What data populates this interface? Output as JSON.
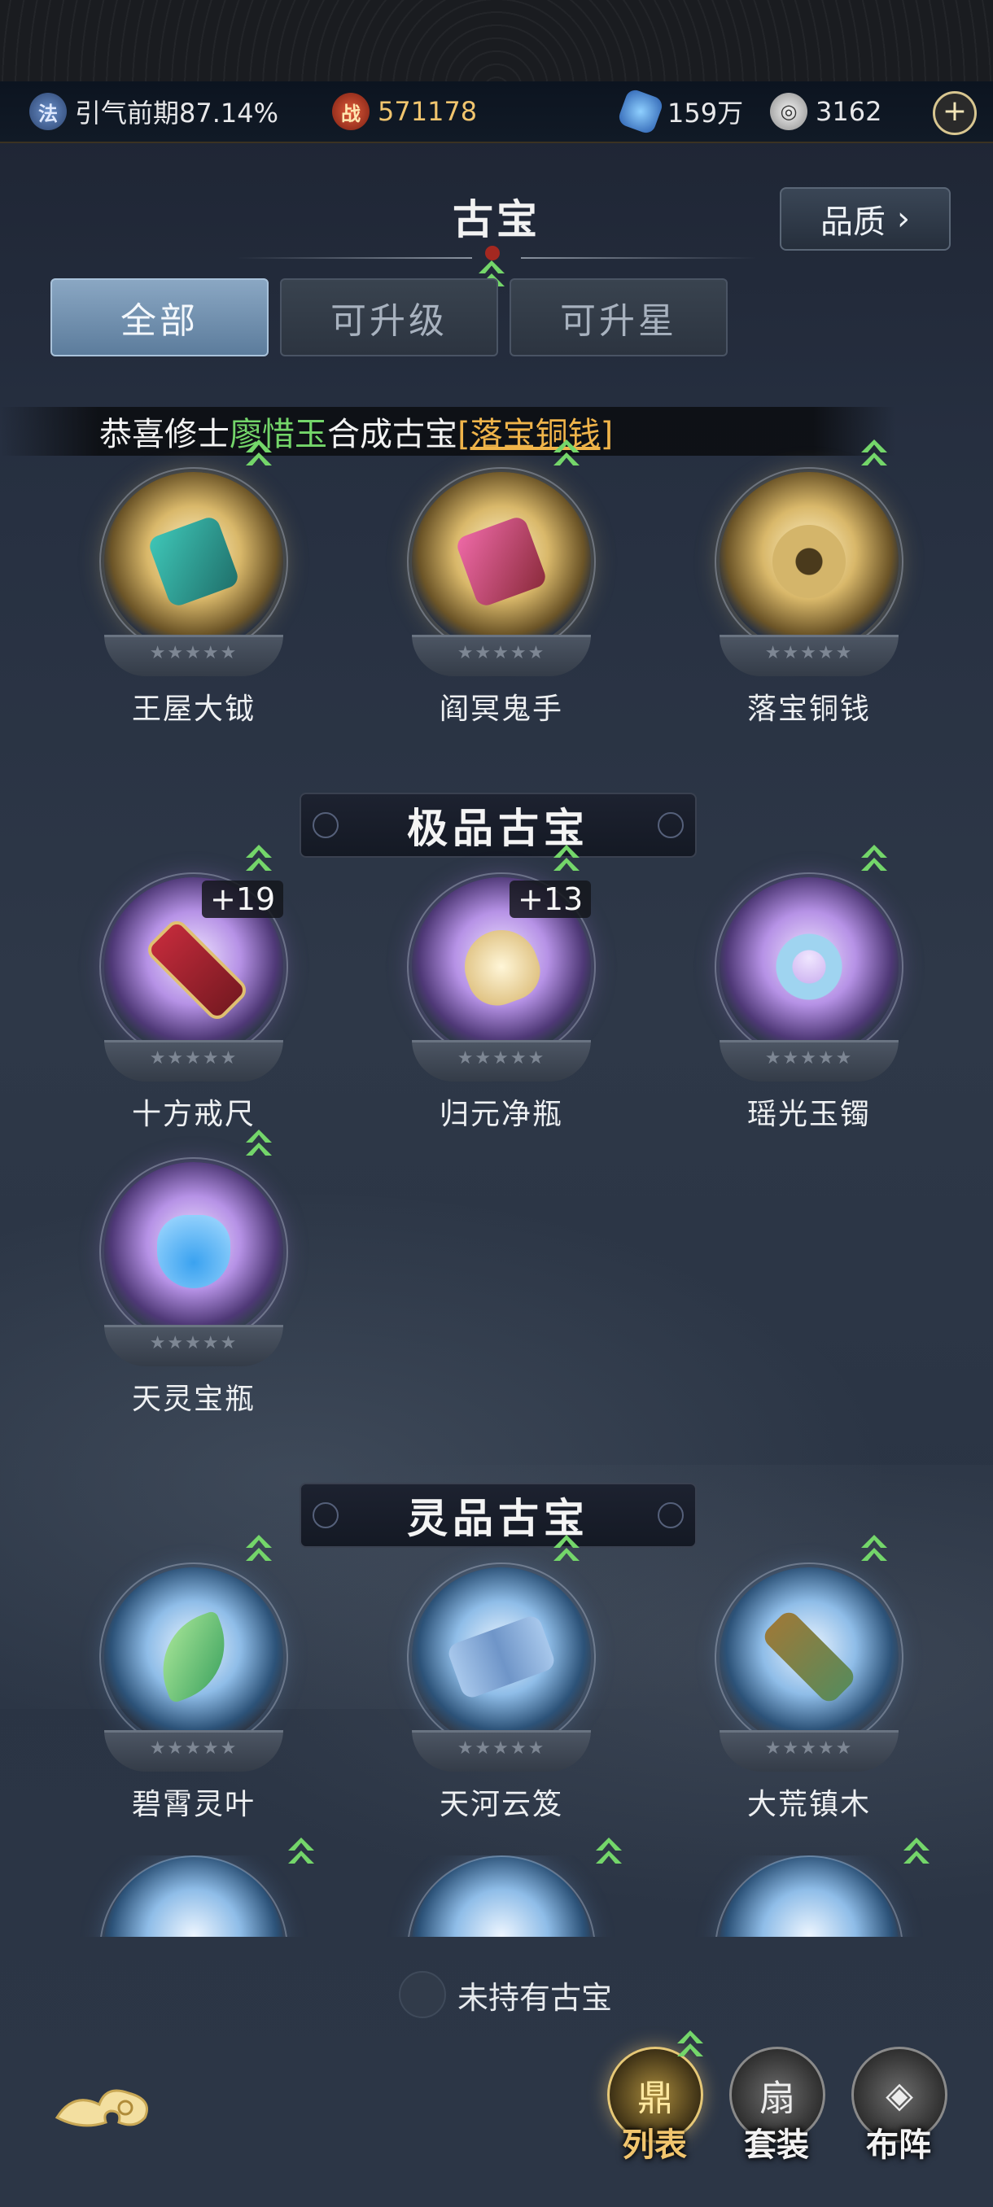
{
  "status": {
    "realm": "引气前期87.14%",
    "power": "571178",
    "gems": "159万",
    "coins": "3162",
    "icon_realm": "fa-seal-icon",
    "icon_power": "zhan-battle-icon",
    "icon_gems": "blue-gem-icon",
    "icon_coins": "silver-coin-icon",
    "power_color": "#f1c56e"
  },
  "header": {
    "title": "古宝",
    "quality_button": "品质",
    "quality_arrow": "›"
  },
  "tabs": [
    {
      "label": "全部",
      "active": true
    },
    {
      "label": "可升级",
      "active": false
    },
    {
      "label": "可升星",
      "active": false
    }
  ],
  "notice": {
    "prefix": "恭喜修士",
    "player": "廖惜玉",
    "middle": "合成古宝",
    "item": "[落宝铜钱]"
  },
  "sections": {
    "rare": "极品古宝",
    "spirit": "灵品古宝"
  },
  "items": {
    "row1": [
      {
        "name": "王屋大钺",
        "level": ""
      },
      {
        "name": "阎冥鬼手",
        "level": ""
      },
      {
        "name": "落宝铜钱",
        "level": ""
      }
    ],
    "row2": [
      {
        "name": "十方戒尺",
        "level": "+19"
      },
      {
        "name": "归元净瓶",
        "level": "+13"
      },
      {
        "name": "瑶光玉镯",
        "level": ""
      }
    ],
    "row3": [
      {
        "name": "天灵宝瓶",
        "level": ""
      }
    ],
    "row4": [
      {
        "name": "碧霄灵叶",
        "level": ""
      },
      {
        "name": "天河云笈",
        "level": ""
      },
      {
        "name": "大荒镇木",
        "level": ""
      }
    ]
  },
  "stars": "★★★★★",
  "filter": {
    "label": "未持有古宝"
  },
  "nav": {
    "list": "列表",
    "suit": "套装",
    "formation": "布阵",
    "list_icon": "cauldron-icon",
    "suit_icon": "fan-icon",
    "formation_icon": "formation-icon",
    "cloud_icon": "auspicious-cloud-icon"
  }
}
